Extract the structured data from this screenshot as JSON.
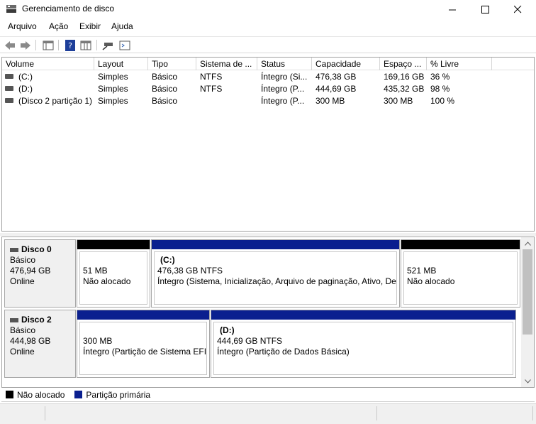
{
  "window": {
    "title": "Gerenciamento de disco",
    "minimize_glyph": "—",
    "maximize_glyph": "☐",
    "close_glyph": "✕"
  },
  "menu": [
    "Arquivo",
    "Ação",
    "Exibir",
    "Ajuda"
  ],
  "toolbar_icons": [
    "back-arrow-icon",
    "forward-arrow-icon",
    "properties-panel-icon",
    "help-icon",
    "view-panel-icon",
    "connect-drive-icon",
    "console-view-icon"
  ],
  "volume_list": {
    "columns": [
      "Volume",
      "Layout",
      "Tipo",
      "Sistema de ...",
      "Status",
      "Capacidade",
      "Espaço ...",
      "% Livre"
    ],
    "rows": [
      [
        "(C:)",
        "Simples",
        "Básico",
        "NTFS",
        "Íntegro (Si...",
        "476,38 GB",
        "169,16 GB",
        "36 %"
      ],
      [
        "(D:)",
        "Simples",
        "Básico",
        "NTFS",
        "Íntegro (P...",
        "444,69 GB",
        "435,32 GB",
        "98 %"
      ],
      [
        "(Disco 2 partição 1)",
        "Simples",
        "Básico",
        "",
        "Íntegro (P...",
        "300 MB",
        "300 MB",
        "100 %"
      ]
    ]
  },
  "disks": [
    {
      "name": "Disco 0",
      "type": "Básico",
      "size": "476,94 GB",
      "state": "Online",
      "partitions": [
        {
          "label": "",
          "size": "51 MB",
          "status": "Não alocado",
          "bar": "#000000"
        },
        {
          "label": "(C:)",
          "size": "476,38 GB NTFS",
          "status": "Íntegro (Sistema, Inicialização, Arquivo de paginação, Ativo, Des",
          "bar": "#0a1f8f"
        },
        {
          "label": "",
          "size": "521 MB",
          "status": "Não alocado",
          "bar": "#000000"
        }
      ]
    },
    {
      "name": "Disco 2",
      "type": "Básico",
      "size": "444,98 GB",
      "state": "Online",
      "partitions": [
        {
          "label": "",
          "size": "300 MB",
          "status": "Íntegro (Partição de Sistema EFI)",
          "bar": "#0a1f8f"
        },
        {
          "label": "(D:)",
          "size": "444,69 GB NTFS",
          "status": "Íntegro (Partição de Dados Básica)",
          "bar": "#0a1f8f"
        }
      ]
    }
  ],
  "legend": [
    {
      "label": "Não alocado",
      "color": "#000000"
    },
    {
      "label": "Partição primária",
      "color": "#0a1f8f"
    }
  ],
  "colors": {
    "unallocated": "#000000",
    "primary_partition": "#0a1f8f"
  }
}
